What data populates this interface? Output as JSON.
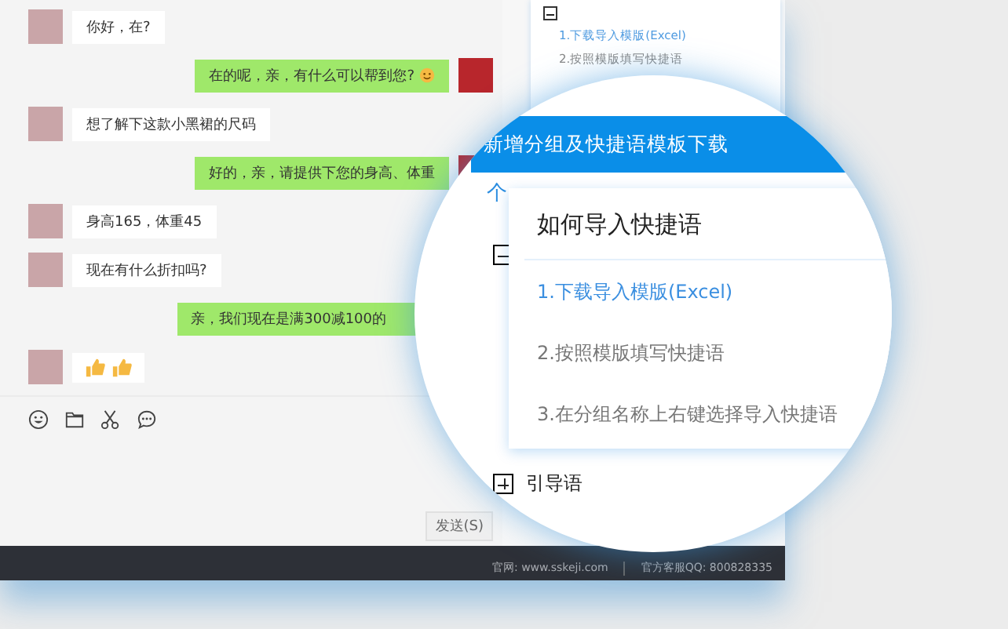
{
  "chat": {
    "messages": [
      {
        "outgoing": false,
        "kind": "text",
        "text": "你好，在?"
      },
      {
        "outgoing": true,
        "kind": "text",
        "text": "在的呢，亲，有什么可以帮到您?",
        "smiley": true
      },
      {
        "outgoing": false,
        "kind": "text",
        "text": "想了解下这款小黑裙的尺码"
      },
      {
        "outgoing": true,
        "kind": "text",
        "text": "好的，亲，请提供下您的身高、体重"
      },
      {
        "outgoing": false,
        "kind": "text",
        "text": "身高165，体重45"
      },
      {
        "outgoing": false,
        "kind": "text",
        "text": "现在有什么折扣吗?"
      },
      {
        "outgoing": true,
        "kind": "text",
        "text": "亲，我们现在是满300减100的",
        "covered": true
      },
      {
        "outgoing": false,
        "kind": "thumbs"
      }
    ],
    "send_button": "发送(S)"
  },
  "side_panel": {
    "items": [
      {
        "text": "1.下载导入模版(Excel)",
        "link": true
      },
      {
        "text": "2.按照模版填写快捷语",
        "link": false
      }
    ]
  },
  "magnifier": {
    "header": "新增分组及快捷语模板下载",
    "tab": "个",
    "popup": {
      "title": "如何导入快捷语",
      "steps": [
        {
          "text": "1.下载导入模版(Excel)",
          "link": true
        },
        {
          "text": "2.按照模版填写快捷语",
          "link": false
        },
        {
          "text": "3.在分组名称上右键选择导入快捷语",
          "link": false
        }
      ]
    },
    "group": {
      "label": "引导语",
      "expanded": false
    }
  },
  "footer": {
    "website": "官网: www.sskeji.com",
    "qq": "官方客服QQ: 800828335"
  }
}
